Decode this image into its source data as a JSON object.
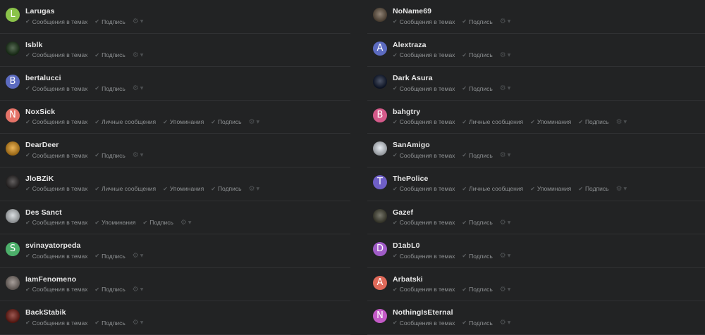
{
  "left_users": [
    {
      "name": "Larugas",
      "avatar": {
        "type": "letter",
        "letter": "L",
        "color": "#8bc34a"
      },
      "options": [
        "Сообщения в темах",
        "Подпись"
      ]
    },
    {
      "name": "Isblk",
      "avatar": {
        "type": "image",
        "icon": "green-figure-icon",
        "color": "#1f3a1c"
      },
      "options": [
        "Сообщения в темах",
        "Подпись"
      ]
    },
    {
      "name": "bertalucci",
      "avatar": {
        "type": "letter",
        "letter": "B",
        "color": "#5c6bc0"
      },
      "options": [
        "Сообщения в темах",
        "Подпись"
      ]
    },
    {
      "name": "NoxSick",
      "avatar": {
        "type": "letter",
        "letter": "N",
        "color": "#e57368"
      },
      "options": [
        "Сообщения в темах",
        "Личные сообщения",
        "Упоминания",
        "Подпись"
      ]
    },
    {
      "name": "DearDeer",
      "avatar": {
        "type": "image",
        "icon": "orange-logo-icon",
        "color": "#e59a1f"
      },
      "options": [
        "Сообщения в темах",
        "Подпись"
      ]
    },
    {
      "name": "JloBZiK",
      "avatar": {
        "type": "image",
        "icon": "dark-creature-icon",
        "color": "#2e2a2a"
      },
      "options": [
        "Сообщения в темах",
        "Личные сообщения",
        "Упоминания",
        "Подпись"
      ]
    },
    {
      "name": "Des Sanct",
      "avatar": {
        "type": "image",
        "icon": "white-skull-icon",
        "color": "#cfd4d8"
      },
      "options": [
        "Сообщения в темах",
        "Упоминания",
        "Подпись"
      ]
    },
    {
      "name": "svinayatorpeda",
      "avatar": {
        "type": "letter",
        "letter": "S",
        "color": "#4caf6a"
      },
      "options": [
        "Сообщения в темах",
        "Подпись"
      ]
    },
    {
      "name": "IamFenomeno",
      "avatar": {
        "type": "image",
        "icon": "portrait-icon",
        "color": "#8a7f79"
      },
      "options": [
        "Сообщения в темах",
        "Подпись"
      ]
    },
    {
      "name": "BackStabik",
      "avatar": {
        "type": "image",
        "icon": "red-fire-icon",
        "color": "#7a1f16"
      },
      "options": [
        "Сообщения в темах",
        "Подпись"
      ]
    }
  ],
  "right_users": [
    {
      "name": "NoName69",
      "avatar": {
        "type": "image",
        "icon": "brown-photo-icon",
        "color": "#6b5a48"
      },
      "options": [
        "Сообщения в темах",
        "Подпись"
      ]
    },
    {
      "name": "Alextraza",
      "avatar": {
        "type": "letter",
        "letter": "A",
        "color": "#5c6bc0"
      },
      "options": [
        "Сообщения в темах",
        "Подпись"
      ]
    },
    {
      "name": "Dark Asura",
      "avatar": {
        "type": "image",
        "icon": "blue-glow-icon",
        "color": "#101a33"
      },
      "options": [
        "Сообщения в темах",
        "Подпись"
      ]
    },
    {
      "name": "bahgtry",
      "avatar": {
        "type": "letter",
        "letter": "B",
        "color": "#d45a8a"
      },
      "options": [
        "Сообщения в темах",
        "Личные сообщения",
        "Упоминания",
        "Подпись"
      ]
    },
    {
      "name": "SanAmigo",
      "avatar": {
        "type": "image",
        "icon": "emblem-icon",
        "color": "#dfe6ee"
      },
      "options": [
        "Сообщения в темах",
        "Подпись"
      ]
    },
    {
      "name": "ThePolice",
      "avatar": {
        "type": "letter",
        "letter": "T",
        "color": "#6f5fc7"
      },
      "options": [
        "Сообщения в темах",
        "Личные сообщения",
        "Упоминания",
        "Подпись"
      ]
    },
    {
      "name": "Gazef",
      "avatar": {
        "type": "image",
        "icon": "knight-icon",
        "color": "#4a4a3a"
      },
      "options": [
        "Сообщения в темах",
        "Подпись"
      ]
    },
    {
      "name": "D1abL0",
      "avatar": {
        "type": "letter",
        "letter": "D",
        "color": "#a05cc7"
      },
      "options": [
        "Сообщения в темах",
        "Подпись"
      ]
    },
    {
      "name": "Arbatski",
      "avatar": {
        "type": "letter",
        "letter": "A",
        "color": "#e06a5a"
      },
      "options": [
        "Сообщения в темах",
        "Подпись"
      ]
    },
    {
      "name": "NothingIsEternal",
      "avatar": {
        "type": "letter",
        "letter": "N",
        "color": "#c45ac7"
      },
      "options": [
        "Сообщения в темах",
        "Подпись"
      ]
    }
  ],
  "icons": {
    "check": "✔",
    "gear": "⚙",
    "caret": "▼"
  }
}
